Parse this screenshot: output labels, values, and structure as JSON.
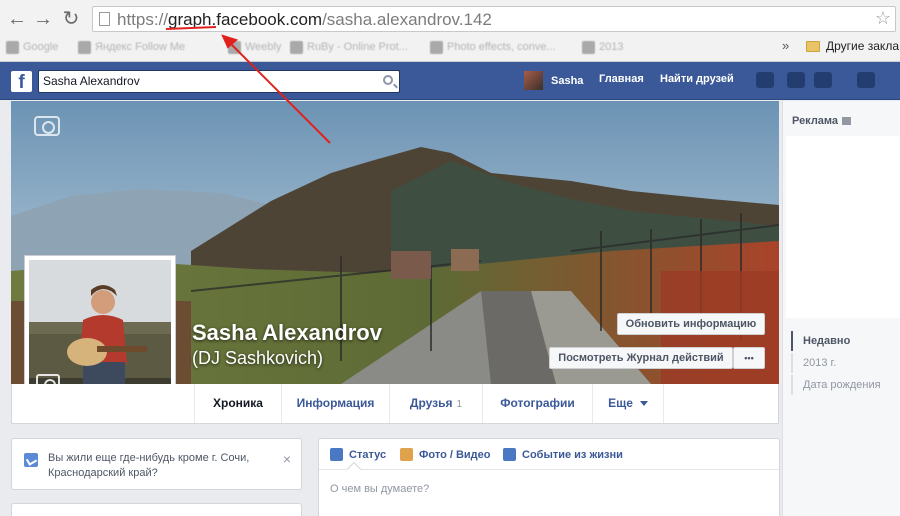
{
  "browser": {
    "back_glyph": "←",
    "forward_glyph": "→",
    "reload_glyph": "↻",
    "url_prefix": "https://",
    "url_host": "graph.facebook.com",
    "url_path": "/sasha.alexandrov.142",
    "star_glyph": "☆",
    "bookmarks": [
      "Google",
      "Яндекс Follow Me",
      "Weebly",
      "RuBy - Online Prot...",
      "Photo effects, conve...",
      "2013"
    ],
    "bookmarks_more": "»",
    "other_bookmarks": "Другие закла"
  },
  "annotation": {
    "color": "#e0211e"
  },
  "fb": {
    "brand_color": "#3b5998",
    "logo": "f",
    "search_value": "Sasha Alexandrov",
    "user_name": "Sasha",
    "nav_home": "Главная",
    "nav_find_friends": "Найти друзей"
  },
  "profile": {
    "name": "Sasha Alexandrov",
    "alt_name": "(DJ Sashkovich)",
    "update_info_button": "Обновить информацию",
    "activity_log_button": "Посмотреть Журнал действий",
    "more_button": "•••"
  },
  "tabs": [
    {
      "label": "Хроника",
      "count": ""
    },
    {
      "label": "Информация",
      "count": ""
    },
    {
      "label": "Друзья",
      "count": "1"
    },
    {
      "label": "Фотографии",
      "count": ""
    },
    {
      "label": "Еще",
      "count": ""
    }
  ],
  "place_card": {
    "text": "Вы жили еще где-нибудь кроме г. Сочи, Краснодарский край?",
    "close": "×"
  },
  "composer": {
    "status": "Статус",
    "photo_video": "Фото / Видео",
    "life_event": "Событие из жизни",
    "placeholder": "О чем вы думаете?"
  },
  "sidebar": {
    "ads_title": "Реклама",
    "scrubber": [
      "Недавно",
      "2013 г.",
      "Дата рождения"
    ]
  }
}
